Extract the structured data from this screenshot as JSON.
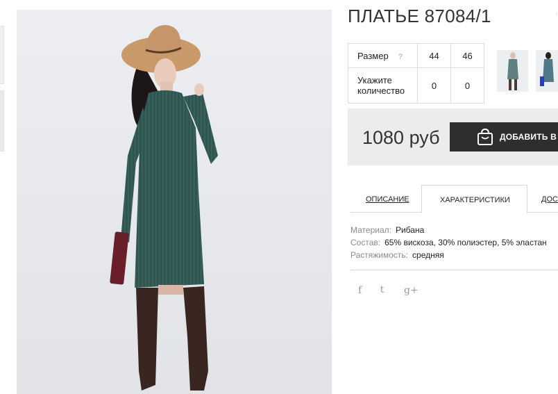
{
  "product": {
    "title": "ПЛАТЬЕ 87084/1"
  },
  "size_table": {
    "size_label": "Размер",
    "help_icon": "?",
    "sizes": [
      "44",
      "46"
    ],
    "quantity_label": "Укажите количество",
    "quantities": [
      "0",
      "0"
    ]
  },
  "price": {
    "value": "1080 руб"
  },
  "cart": {
    "add_label": "ДОБАВИТЬ В ЗА"
  },
  "tabs": [
    {
      "label": "ОПИСАНИЕ"
    },
    {
      "label": "ХАРАКТЕРИСТИКИ",
      "active": true
    },
    {
      "label": "ДОСТ"
    }
  ],
  "specs": [
    {
      "key": "Материал:",
      "value": "Рибана"
    },
    {
      "key": "Состав:",
      "value": "65% вискоза, 30% полиэстер, 5% эластан"
    },
    {
      "key": "Растяжимость:",
      "value": "средняя"
    }
  ],
  "social": {
    "facebook": "f",
    "twitter": "t",
    "googleplus": "g+"
  },
  "colors": {
    "dress": "#2f5550",
    "hat": "#c89a6a",
    "boots": "#3a2620",
    "button": "#2e2e2e",
    "price_bg": "#ececec"
  }
}
